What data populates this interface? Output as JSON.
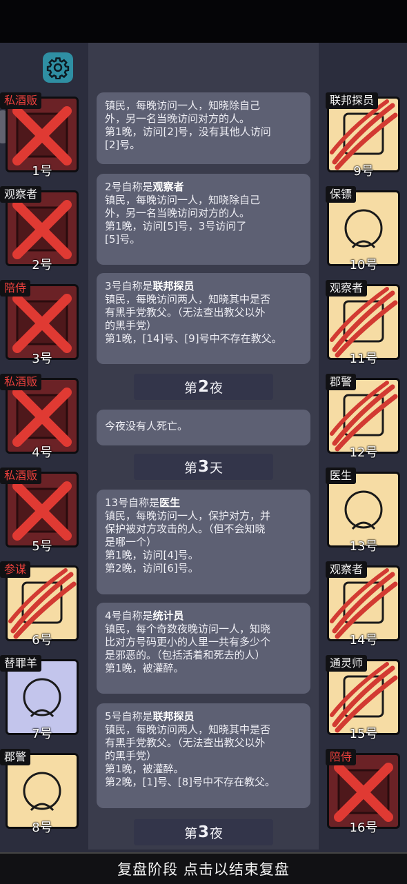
{
  "bottom_bar": "复盘阶段 点击以结束复盘",
  "settings_icon": "gear-icon",
  "log": {
    "card0": {
      "l1": "镇民，每晚访问一人，知晓除自己",
      "l2": "外，另一名当晚访问对方的人。",
      "l3": "第1晚，访问[2]号，没有其他人访问",
      "l4": "[2]号。"
    },
    "card1": {
      "prefix": "2号自称是",
      "role": "观察者",
      "l1": "镇民，每晚访问一人，知晓除自己",
      "l2": "外，另一名当晚访问对方的人。",
      "l3": "第1晚，访问[5]号，3号访问了",
      "l4": "[5]号。"
    },
    "card2": {
      "prefix": "3号自称是",
      "role": "联邦探员",
      "l1": "镇民，每晚访问两人，知晓其中是否",
      "l2": "有黑手党教父。（无法查出教父以外",
      "l3": "的黑手党）",
      "l4": "第1晚，[14]号、[9]号中不存在教父。"
    },
    "div1": {
      "pre": "第",
      "num": "2",
      "post": "夜"
    },
    "card3": {
      "l1": "今夜没有人死亡。"
    },
    "div2": {
      "pre": "第",
      "num": "3",
      "post": "天"
    },
    "card4": {
      "prefix": "13号自称是",
      "role": "医生",
      "l1": "镇民，每晚访问一人，保护对方，并",
      "l2": "保护被对方攻击的人。（但不会知晓",
      "l3": "是哪一个）",
      "l4": "第1晚，访问[4]号。",
      "l5": "第2晚，访问[6]号。"
    },
    "card5": {
      "prefix": "4号自称是",
      "role": "统计员",
      "l1": "镇民，每个奇数夜晚访问一人，知晓",
      "l2": "比对方号码更小的人里一共有多少个",
      "l3": "是邪恶的。（包括活着和死去的人）",
      "l4": "第1晚，被灌醉。"
    },
    "card6": {
      "prefix": "5号自称是",
      "role": "联邦探员",
      "l1": "镇民，每晚访问两人，知晓其中是否",
      "l2": "有黑手党教父。（无法查出教父以外",
      "l3": "的黑手党）",
      "l4": "第1晚，被灌醉。",
      "l5": "第2晚，[1]号、[8]号中不存在教父。"
    },
    "div3": {
      "pre": "第",
      "num": "3",
      "post": "夜"
    }
  },
  "left_players": [
    {
      "role": "私酒贩",
      "number": "1号",
      "status": "dead-x"
    },
    {
      "role": "观察者",
      "number": "2号",
      "status": "dead-x"
    },
    {
      "role": "陪侍",
      "number": "3号",
      "status": "dead-x"
    },
    {
      "role": "私酒贩",
      "number": "4号",
      "status": "dead-x"
    },
    {
      "role": "私酒贩",
      "number": "5号",
      "status": "dead-x"
    },
    {
      "role": "参谋",
      "number": "6号",
      "status": "claw"
    },
    {
      "role": "替罪羊",
      "number": "7号",
      "status": "alive"
    },
    {
      "role": "郡警",
      "number": "8号",
      "status": "alive"
    }
  ],
  "right_players": [
    {
      "role": "联邦探员",
      "number": "9号",
      "status": "claw"
    },
    {
      "role": "保镖",
      "number": "10号",
      "status": "alive"
    },
    {
      "role": "观察者",
      "number": "11号",
      "status": "claw"
    },
    {
      "role": "郡警",
      "number": "12号",
      "status": "claw"
    },
    {
      "role": "医生",
      "number": "13号",
      "status": "alive"
    },
    {
      "role": "观察者",
      "number": "14号",
      "status": "claw"
    },
    {
      "role": "通灵师",
      "number": "15号",
      "status": "claw"
    },
    {
      "role": "陪侍",
      "number": "16号",
      "status": "dead-x"
    }
  ],
  "colors": {
    "evil_tag": "#e8403c",
    "dead_card": "#6b2226",
    "card_bg": "#f6dca4"
  }
}
